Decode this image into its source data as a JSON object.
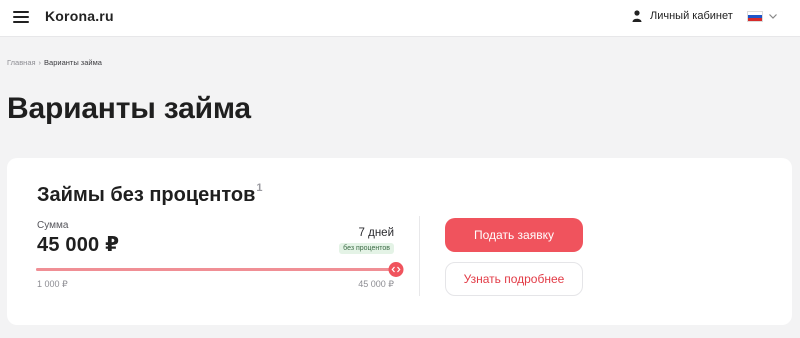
{
  "header": {
    "logo": "Korona.ru",
    "cabinet_label": "Личный кабинет",
    "menu_icon": "hamburger-menu-icon",
    "cabinet_icon": "person-icon",
    "language_icon": "russian-flag-icon",
    "language_dropdown_icon": "chevron-down-icon"
  },
  "breadcrumb": {
    "home": "Главная",
    "separator": "›",
    "current": "Варианты займа"
  },
  "page": {
    "title": "Варианты займа"
  },
  "loan_card": {
    "title": "Займы без процентов",
    "title_footnote": "1",
    "amount_label": "Сумма",
    "amount_value": "45 000 ₽",
    "term": "7 дней",
    "badge": "без процентов",
    "slider": {
      "min_label": "1 000 ₽",
      "max_label": "45 000 ₽",
      "min": 1000,
      "max": 45000,
      "value": 45000,
      "handle_icon": "arrows-left-right-icon"
    },
    "apply_button": "Подать заявку",
    "details_button": "Узнать подробнее"
  },
  "colors": {
    "accent": "#f0535d",
    "slider_track": "#f7c3c6",
    "badge_bg": "#e4f3e6",
    "page_bg": "#f3f3f4"
  }
}
